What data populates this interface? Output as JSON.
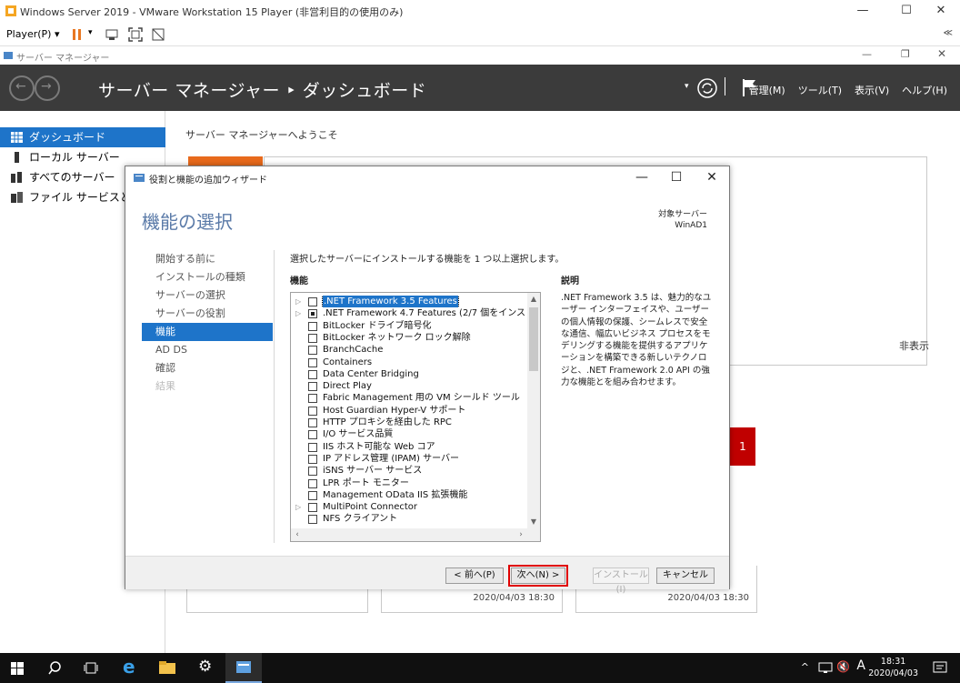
{
  "vmware": {
    "window_title": "Windows Server 2019 - VMware Workstation 15 Player (非営利目的の使用のみ)",
    "player_menu": "Player(P) ▾",
    "collapse": "≪",
    "controls": {
      "minimize": "—",
      "maximize": "☐",
      "close": "✕"
    }
  },
  "server_manager": {
    "window_title": "サーバー マネージャー",
    "breadcrumb": "サーバー マネージャー ‣ ダッシュボード",
    "menus": [
      "管理(M)",
      "ツール(T)",
      "表示(V)",
      "ヘルプ(H)"
    ],
    "nav": [
      {
        "label": "ダッシュボード",
        "icon": "dashboard-icon",
        "active": true
      },
      {
        "label": "ローカル サーバー",
        "icon": "server-icon"
      },
      {
        "label": "すべてのサーバー",
        "icon": "servers-icon"
      },
      {
        "label": "ファイル サービスと記憶",
        "icon": "file-services-icon"
      }
    ],
    "welcome": "サーバー マネージャーへようこそ",
    "hide": "非表示",
    "badge_count": "1",
    "timestamps": [
      "2020/04/03 18:30",
      "2020/04/03 18:30"
    ]
  },
  "wizard": {
    "title": "役割と機能の追加ウィザード",
    "heading": "機能の選択",
    "target_label": "対象サーバー",
    "target_server": "WinAD1",
    "steps": [
      {
        "label": "開始する前に",
        "state": "normal"
      },
      {
        "label": "インストールの種類",
        "state": "normal"
      },
      {
        "label": "サーバーの選択",
        "state": "normal"
      },
      {
        "label": "サーバーの役割",
        "state": "normal"
      },
      {
        "label": "機能",
        "state": "active"
      },
      {
        "label": "AD DS",
        "state": "normal"
      },
      {
        "label": "確認",
        "state": "normal"
      },
      {
        "label": "結果",
        "state": "disabled"
      }
    ],
    "instruction": "選択したサーバーにインストールする機能を 1 つ以上選択します。",
    "features_label": "機能",
    "description_label": "説明",
    "description": ".NET Framework 3.5 は、魅力的なユーザー インターフェイスや、ユーザーの個人情報の保護、シームレスで安全な通信、幅広いビジネス プロセスをモデリングする機能を提供するアプリケーションを構築できる新しいテクノロジと、.NET Framework 2.0 API の強力な機能とを組み合わせます。",
    "features": [
      {
        "label": ".NET Framework 3.5 Features",
        "expander": true,
        "state": "unchecked",
        "selected": true
      },
      {
        "label": ".NET Framework 4.7 Features (2/7 個をインストール済",
        "expander": true,
        "state": "partial"
      },
      {
        "label": "BitLocker ドライブ暗号化",
        "state": "unchecked"
      },
      {
        "label": "BitLocker ネットワーク ロック解除",
        "state": "unchecked"
      },
      {
        "label": "BranchCache",
        "state": "unchecked"
      },
      {
        "label": "Containers",
        "state": "unchecked"
      },
      {
        "label": "Data Center Bridging",
        "state": "unchecked"
      },
      {
        "label": "Direct Play",
        "state": "unchecked"
      },
      {
        "label": "Fabric Management 用の VM シールド ツール",
        "state": "unchecked"
      },
      {
        "label": "Host Guardian Hyper-V サポート",
        "state": "unchecked"
      },
      {
        "label": "HTTP プロキシを経由した RPC",
        "state": "unchecked"
      },
      {
        "label": "I/O サービス品質",
        "state": "unchecked"
      },
      {
        "label": "IIS ホスト可能な Web コア",
        "state": "unchecked"
      },
      {
        "label": "IP アドレス管理 (IPAM) サーバー",
        "state": "unchecked"
      },
      {
        "label": "iSNS サーバー サービス",
        "state": "unchecked"
      },
      {
        "label": "LPR ポート モニター",
        "state": "unchecked"
      },
      {
        "label": "Management OData IIS 拡張機能",
        "state": "unchecked"
      },
      {
        "label": "MultiPoint Connector",
        "expander": true,
        "state": "unchecked"
      },
      {
        "label": "NFS クライアント",
        "state": "unchecked"
      }
    ],
    "buttons": {
      "prev": "< 前へ(P)",
      "next": "次へ(N) >",
      "install": "インストール(I)",
      "cancel": "キャンセル"
    }
  },
  "taskbar": {
    "time": "18:31",
    "date": "2020/04/03",
    "ime": "A"
  },
  "colors": {
    "accent": "#1e74c9",
    "header": "#3b3b3b",
    "badge": "#c00000",
    "highlight": "#e00000"
  }
}
